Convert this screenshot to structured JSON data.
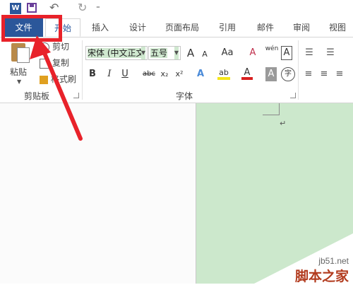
{
  "quick_access": {
    "app_logo": "W",
    "icons": [
      "word-logo-icon",
      "save-icon",
      "undo-icon",
      "redo-icon",
      "customize-qat-icon"
    ],
    "undo": "↶",
    "redo": "↻",
    "more": "⁼"
  },
  "tabs": [
    {
      "label": "文件"
    },
    {
      "label": "开始"
    },
    {
      "label": "插入"
    },
    {
      "label": "设计"
    },
    {
      "label": "页面布局"
    },
    {
      "label": "引用"
    },
    {
      "label": "邮件"
    },
    {
      "label": "审阅"
    },
    {
      "label": "视图"
    }
  ],
  "clipboard": {
    "paste": "粘贴",
    "cut": "剪切",
    "copy": "复制",
    "format_painter": "格式刷",
    "group_label": "剪贴板"
  },
  "font": {
    "font_name": "宋体 (中文正文",
    "font_size": "五号",
    "grow": "A",
    "shrink": "A",
    "change_case": "Aa",
    "clear_format": "A",
    "phonetic": "wén",
    "char_border": "A",
    "bold": "B",
    "italic": "I",
    "underline": "U",
    "strikethrough": "abc",
    "subscript": "x₂",
    "superscript": "x²",
    "text_effect": "A",
    "highlight": "ab",
    "font_color": "A",
    "shading": "A",
    "enclose": "字",
    "group_label": "字体"
  },
  "document": {
    "paragraph_mark": "↵"
  },
  "watermark": {
    "url": "jb51.net",
    "name": "脚本之家"
  },
  "colors": {
    "accent": "#2b579a",
    "annotation": "#e8222a",
    "page": "#cce8cc"
  }
}
